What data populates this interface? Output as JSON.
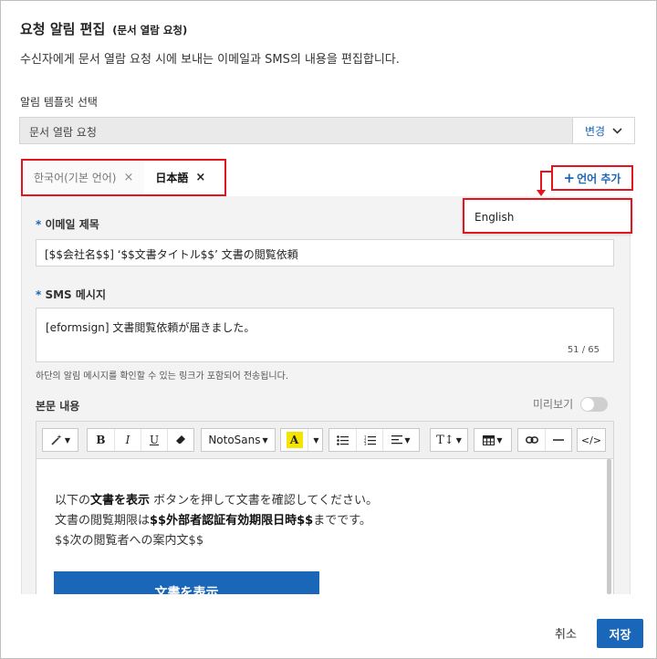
{
  "dialog": {
    "title": "요청 알림 편집",
    "title_sub": "(문서 열람 요청)",
    "description": "수신자에게 문서 열람 요청 시에 보내는 이메일과 SMS의 내용을 편집합니다."
  },
  "template": {
    "label": "알림 템플릿 선택",
    "value": "문서 열람 요청",
    "change_label": "변경"
  },
  "languages": {
    "tabs": [
      {
        "label": "한국어(기본 언어)",
        "active": false
      },
      {
        "label": "日本語",
        "active": true
      }
    ],
    "add_label": "언어 추가",
    "dropdown_options": [
      "English"
    ]
  },
  "email": {
    "label": "이메일 제목",
    "value": "[$$会社名$$] ‘$$文書タイトル$$’ 文書の閲覧依頼"
  },
  "sms": {
    "label": "SMS 메시지",
    "value": "[eformsign] 文書閲覧依頼が届きました。",
    "count": "51 / 65",
    "note": "하단의 알림 메시지를 확인할 수 있는 링크가 포함되어 전송됩니다."
  },
  "body": {
    "label": "본문 내용",
    "preview_label": "미리보기",
    "toolbar": {
      "font_name": "NotoSans"
    },
    "editor": {
      "line1_pre": "以下の",
      "line1_bold": "文書を表示",
      "line1_post": " ボタンを押して文書を確認してください。",
      "line2_pre": "文書の閲覧期限は",
      "line2_bold": "$$外部者認証有効期限日時$$",
      "line2_post": "までです。",
      "line3": "$$次の閲覧者への案内文$$",
      "button_label": "文書を表示"
    }
  },
  "footer": {
    "cancel_label": "취소",
    "save_label": "저장"
  },
  "colors": {
    "accent": "#1a66b8",
    "highlight_red": "#e3141e"
  }
}
